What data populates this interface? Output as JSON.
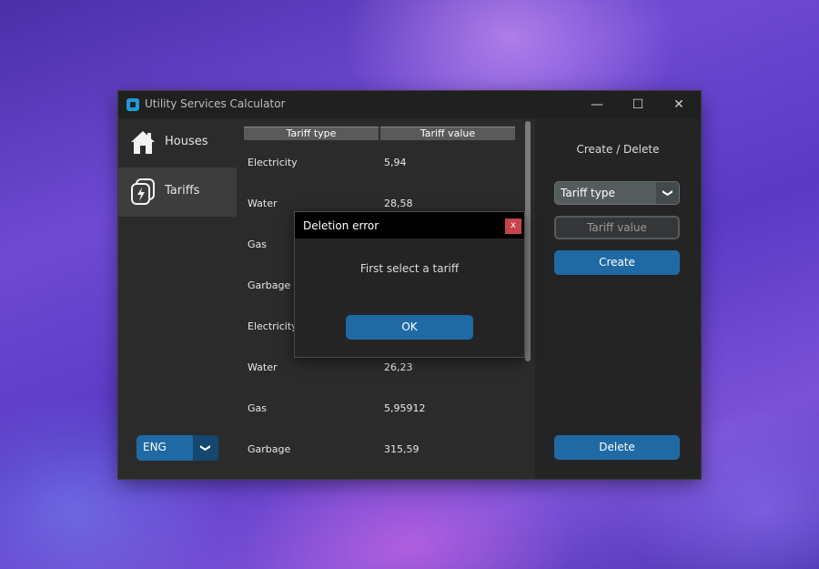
{
  "window": {
    "title": "Utility Services Calculator",
    "controls": {
      "minimize": "—",
      "maximize": "☐",
      "close": "✕"
    }
  },
  "sidebar": {
    "items": [
      {
        "label": "Houses",
        "icon": "house-icon",
        "active": false
      },
      {
        "label": "Tariffs",
        "icon": "tariffs-icon",
        "active": true
      }
    ],
    "language": {
      "value": "ENG",
      "arrow": "❯"
    }
  },
  "table": {
    "headers": [
      "Tariff type",
      "Tariff value"
    ],
    "rows": [
      {
        "type": "Electricity",
        "value": "5,94"
      },
      {
        "type": "Water",
        "value": "28,58"
      },
      {
        "type": "Gas",
        "value": ""
      },
      {
        "type": "Garbage",
        "value": ""
      },
      {
        "type": "Electricity",
        "value": ""
      },
      {
        "type": "Water",
        "value": "26,23"
      },
      {
        "type": "Gas",
        "value": "5,95912"
      },
      {
        "type": "Garbage",
        "value": "315,59"
      }
    ]
  },
  "panel": {
    "title": "Create / Delete",
    "tariff_type": {
      "value": "Tariff type",
      "arrow": "❯"
    },
    "tariff_value": {
      "placeholder": "Tariff value"
    },
    "create_label": "Create",
    "delete_label": "Delete"
  },
  "dialog": {
    "title": "Deletion error",
    "close": "x",
    "message": "First select a tariff",
    "ok_label": "OK"
  },
  "colors": {
    "accent": "#1f6aa5",
    "accent_dark": "#144870",
    "window_bg": "#242424",
    "sidebar_bg": "#2b2b2b",
    "close_red": "#c8434a"
  }
}
